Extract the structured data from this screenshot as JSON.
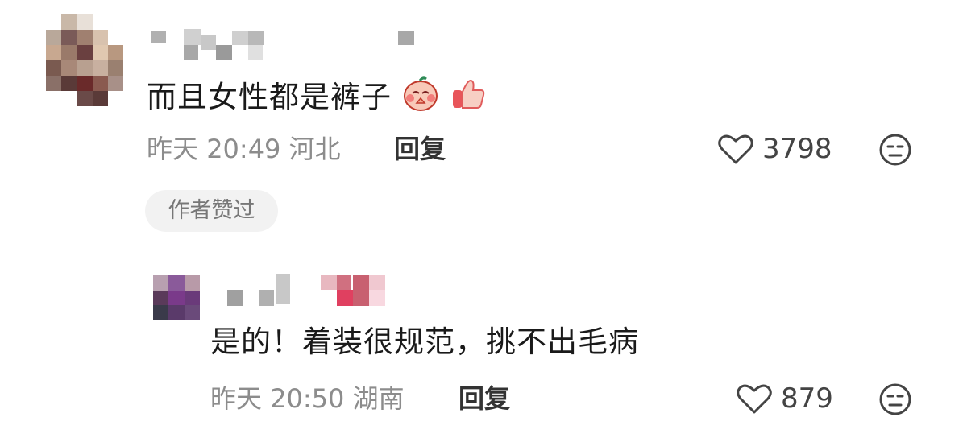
{
  "comments": [
    {
      "text": "而且女性都是裤子",
      "emojis": [
        "face-praying-icon",
        "thumbs-up-icon"
      ],
      "date": "昨天",
      "time": "20:49",
      "location": "河北",
      "reply_label": "回复",
      "likes": "3798",
      "author_badge": "作者赞过"
    },
    {
      "text": "是的！着装很规范，挑不出毛病",
      "date": "昨天",
      "time": "20:50",
      "location": "湖南",
      "reply_label": "回复",
      "likes": "879"
    }
  ],
  "colors": {
    "meta": "#8c8c8c",
    "badge_bg": "#f2f2f2",
    "icon": "#444444"
  }
}
